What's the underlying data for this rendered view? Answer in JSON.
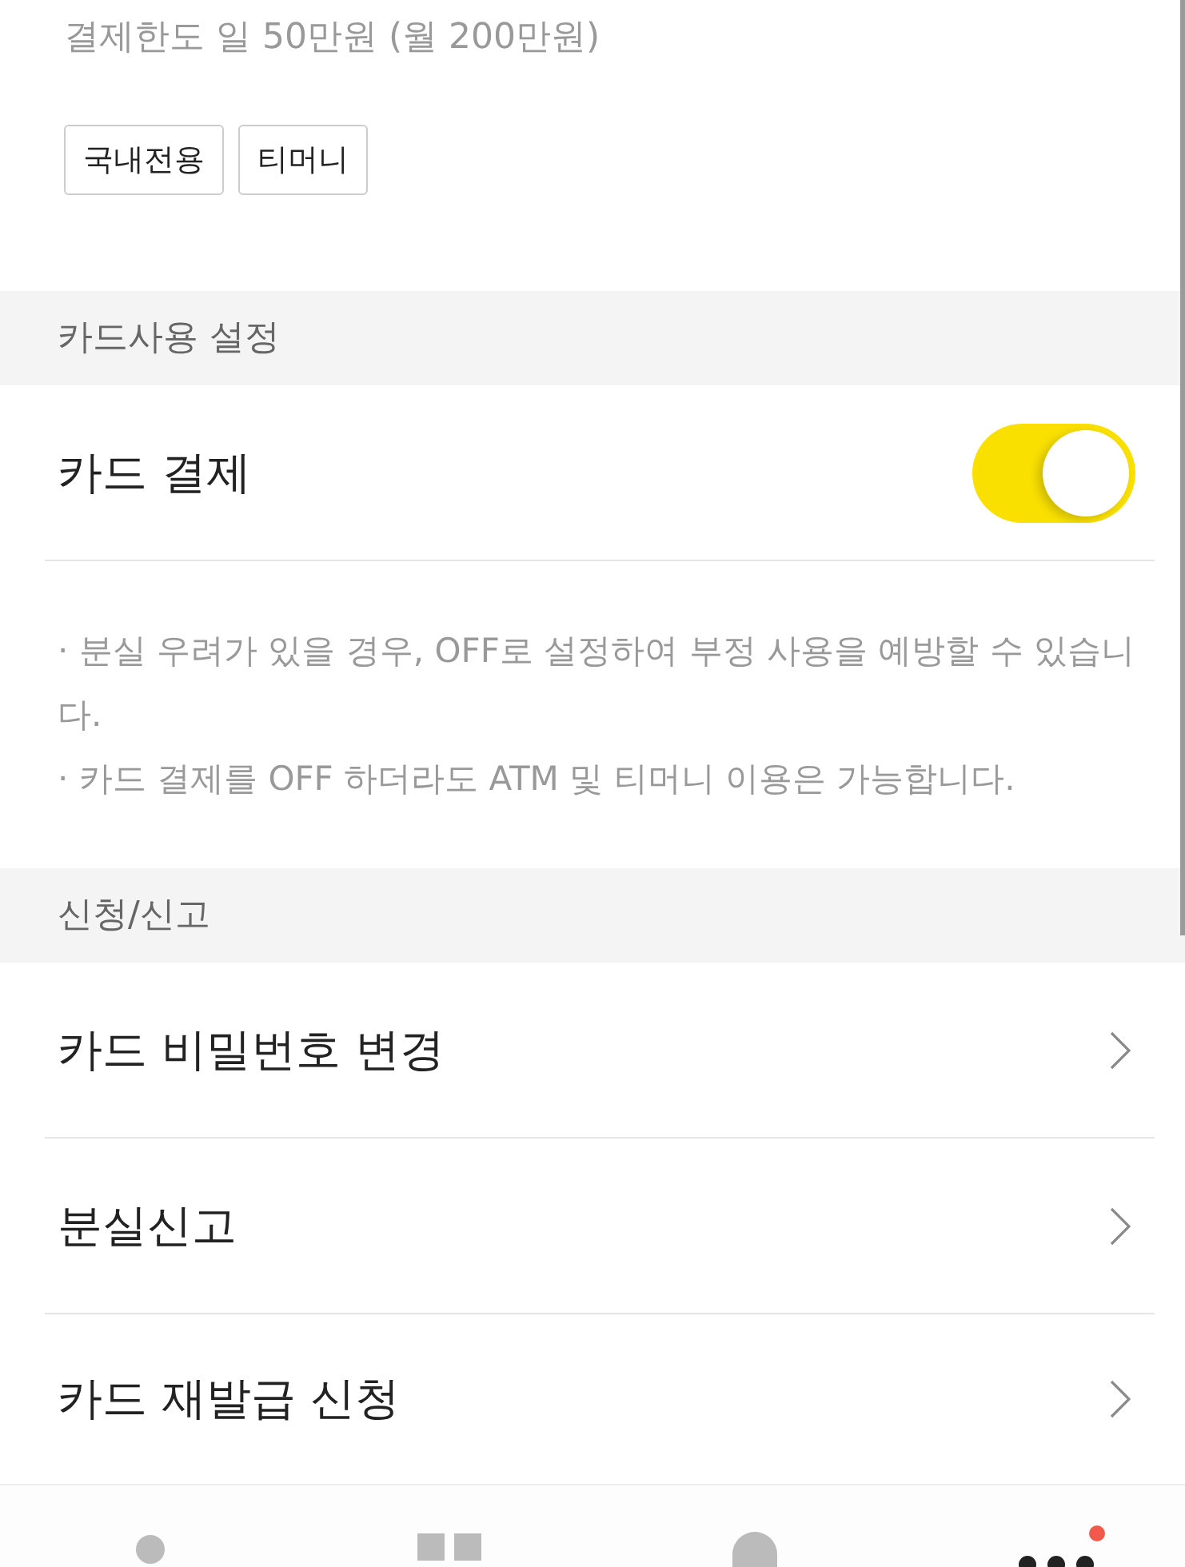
{
  "limit_text": "결제한도 일 50만원 (월 200만원)",
  "tags": [
    "국내전용",
    "티머니"
  ],
  "sections": [
    {
      "title": "카드사용 설정",
      "items": [
        {
          "kind": "toggle",
          "label": "카드 결제",
          "on": true
        }
      ],
      "notes": [
        "· 분실 우려가 있을 경우, OFF로 설정하여 부정 사용을 예방할 수 있습니다.",
        "· 카드 결제를 OFF 하더라도 ATM 및 티머니 이용은 가능합니다."
      ]
    },
    {
      "title": "신청/신고",
      "items": [
        {
          "kind": "link",
          "label": "카드 비밀번호 변경"
        },
        {
          "kind": "link",
          "label": "분실신고"
        },
        {
          "kind": "link",
          "label": "카드 재발급 신청"
        }
      ]
    }
  ],
  "bottom_nav": [
    {
      "kind": "dot",
      "selected": false,
      "badge": false
    },
    {
      "kind": "squares",
      "selected": false,
      "badge": false
    },
    {
      "kind": "dome",
      "selected": false,
      "badge": false
    },
    {
      "kind": "dots",
      "selected": true,
      "badge": true
    }
  ]
}
